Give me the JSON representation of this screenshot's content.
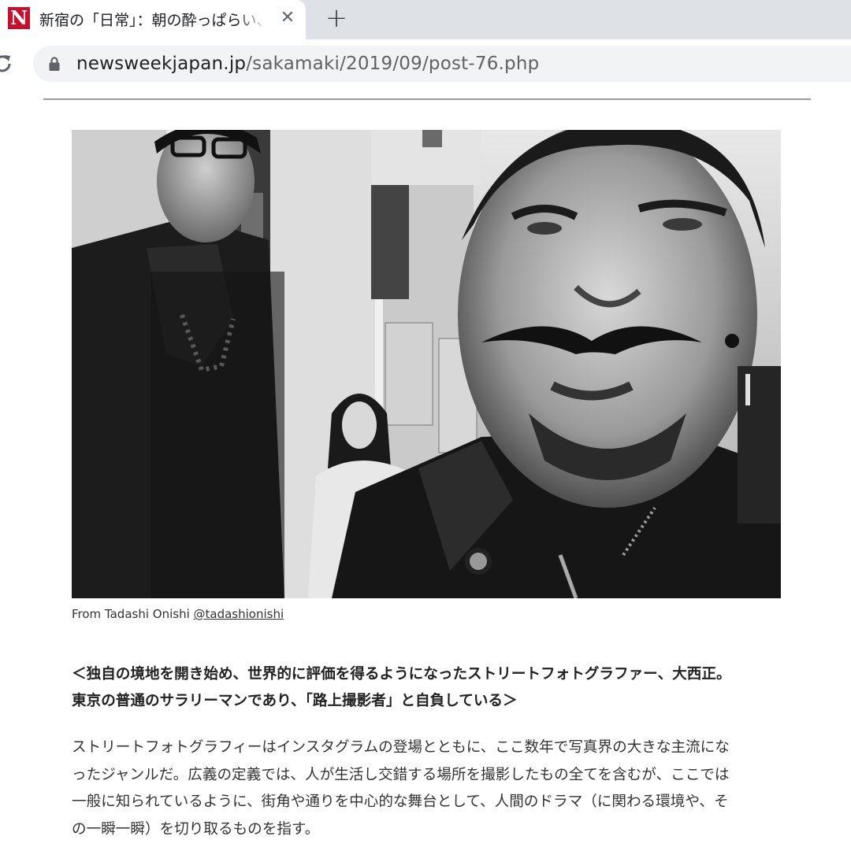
{
  "browser": {
    "tab_title": "新宿の「日常」：朝の酔っぱらい、",
    "favicon_letter": "N",
    "close_glyph": "✕",
    "new_tab_glyph": "+",
    "url_host": "newsweekjapan.jp",
    "url_path": "/sakamaki/2019/09/post-76.php",
    "icons": [
      "reload-icon",
      "lock-icon",
      "close-icon",
      "plus-icon"
    ]
  },
  "article": {
    "photo_description_icon": "street-photo",
    "caption_prefix": "From Tadashi Onishi ",
    "caption_link": "@tadashionishi",
    "lead_line1": "＜独自の境地を開き始め、世界的に評価を得るようになったストリートフォトグラファー、大西正。",
    "lead_line2": "東京の普通のサラリーマンであり、「路上撮影者」と自負している＞",
    "body_line1": "ストリートフォトグラフィーはインスタグラムの登場とともに、ここ数年で写真界の大きな主流にな",
    "body_line2": "ったジャンルだ。広義の定義では、人が生活し交錯する場所を撮影したもの全てを含むが、ここでは",
    "body_line3": "一般に知られているように、街角や通りを中心的な舞台として、人間のドラマ（に関わる環境や、そ",
    "body_line4": "の一瞬一瞬）を切り取るものを指す。"
  },
  "colors": {
    "brand_red": "#c8102e",
    "tabstrip": "#dee1e6",
    "omnibox": "#f1f3f4"
  }
}
